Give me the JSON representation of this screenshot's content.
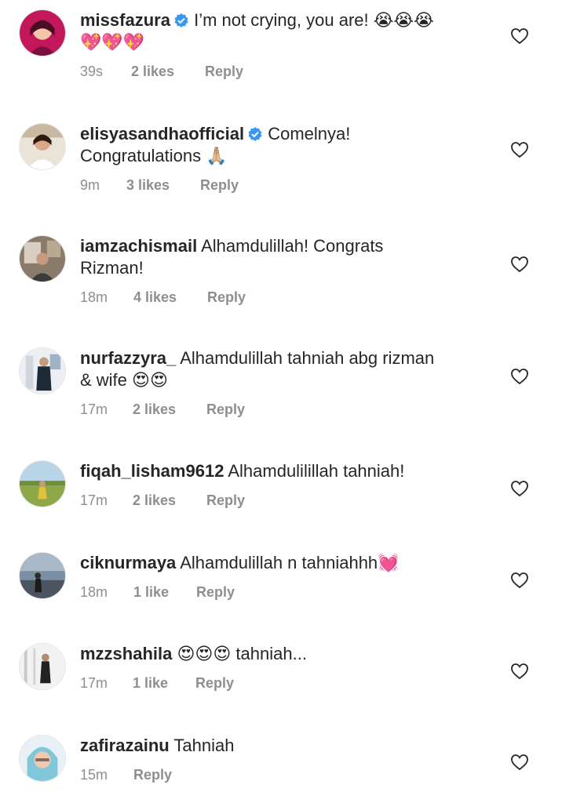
{
  "comments": [
    {
      "username": "missfazura",
      "verified": true,
      "text": "I’m not crying, you are! 😭😭😭\n💖💖💖",
      "time": "39s",
      "likes": "2 likes",
      "reply": "Reply"
    },
    {
      "username": "elisyasandhaofficial",
      "verified": true,
      "text": "Comelnya!\nCongratulations 🙏🏼",
      "time": "9m",
      "likes": "3 likes",
      "reply": "Reply"
    },
    {
      "username": "iamzachismail",
      "verified": false,
      "text": "Alhamdulillah! Congrats\nRizman!",
      "time": "18m",
      "likes": "4 likes",
      "reply": "Reply"
    },
    {
      "username": "nurfazzyra_",
      "verified": false,
      "text": "Alhamdulillah tahniah abg rizman\n& wife 😍😍",
      "time": "17m",
      "likes": "2 likes",
      "reply": "Reply"
    },
    {
      "username": "fiqah_lisham9612",
      "verified": false,
      "text": "Alhamdulilillah tahniah!",
      "time": "17m",
      "likes": "2 likes",
      "reply": "Reply"
    },
    {
      "username": "ciknurmaya",
      "verified": false,
      "text": "Alhamdulillah n tahniahhh💓",
      "time": "18m",
      "likes": "1 like",
      "reply": "Reply"
    },
    {
      "username": "mzzshahila",
      "verified": false,
      "text": "😍😍😍 tahniah...",
      "time": "17m",
      "likes": "1 like",
      "reply": "Reply"
    },
    {
      "username": "zafirazainu",
      "verified": false,
      "text": "Tahniah",
      "time": "15m",
      "likes": "",
      "reply": "Reply"
    }
  ],
  "colors": {
    "text": "#262626",
    "meta": "#8e8e8e",
    "verified": "#3897f0"
  },
  "icons": {
    "heart": "heart-outline-icon",
    "verified": "verified-badge-icon"
  }
}
